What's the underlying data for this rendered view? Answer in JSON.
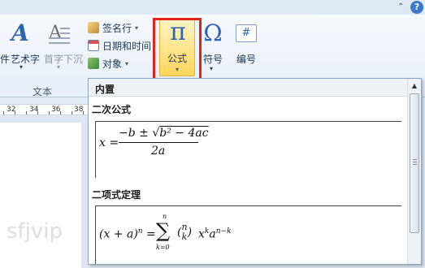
{
  "ribbon": {
    "text_group_label": "文本",
    "wordart_label": "艺术字",
    "wordart_prefix": "件",
    "dropcap_label": "首字下沉",
    "signature_label": "签名行",
    "datetime_label": "日期和时间",
    "object_label": "对象",
    "formula_label": "公式",
    "symbol_label": "符号",
    "number_label": "编号"
  },
  "ruler": {
    "ticks": [
      "32",
      "34",
      "36",
      "38"
    ]
  },
  "panel": {
    "header": "内置",
    "sections": [
      {
        "title": "二次公式"
      },
      {
        "title": "二项式定理"
      }
    ]
  },
  "watermark": "sfjvip"
}
